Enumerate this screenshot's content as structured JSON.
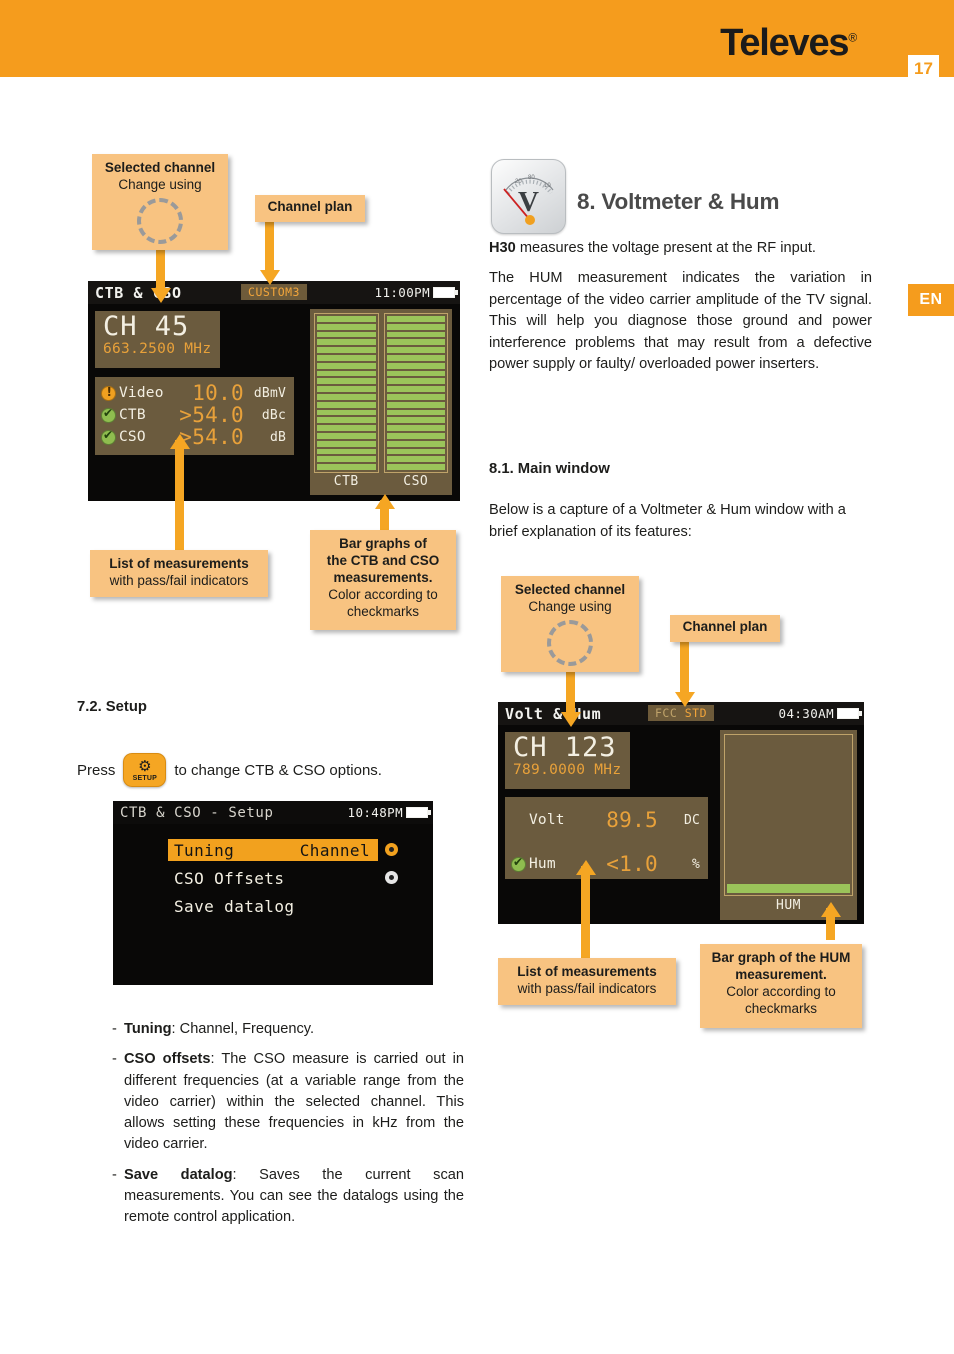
{
  "header": {
    "brand": "Televes",
    "brand_mark": "®",
    "page_number": "17",
    "accent_color": "#F59C1D"
  },
  "language_tab": {
    "label": "EN"
  },
  "left_column": {
    "screen1": {
      "title": "CTB & CSO",
      "channel_plan": "CUSTOM3",
      "time": "11:00PM",
      "channel": "CH 45",
      "frequency": "663.2500 MHz",
      "measurements": [
        {
          "icon": "warning-icon",
          "label": "Video",
          "value": "10.0",
          "unit": "dBmV"
        },
        {
          "icon": "check-icon",
          "label": "CTB",
          "value": ">54.0",
          "unit": "dBc"
        },
        {
          "icon": "check-icon",
          "label": "CSO",
          "value": ">54.0",
          "unit": "dB"
        }
      ],
      "bars": [
        {
          "label": "CTB",
          "segments": 20,
          "color": "#9BC45A"
        },
        {
          "label": "CSO",
          "segments": 20,
          "color": "#9BC45A"
        }
      ]
    },
    "callouts": {
      "selected_channel_title": "Selected channel",
      "selected_channel_sub": "Change using",
      "channel_plan": "Channel plan",
      "list_title": "List of measurements",
      "list_sub": "with pass/fail indicators",
      "bars_line1": "Bar graphs of",
      "bars_line2": "the CTB and CSO",
      "bars_line3": "measurements.",
      "bars_line4": "Color according to",
      "bars_line5": "checkmarks"
    },
    "setup_heading": "7.2. Setup",
    "setup_press_before": "Press",
    "setup_key_label": "SETUP",
    "setup_press_after": "to change CTB & CSO options.",
    "screen2": {
      "title": "CTB & CSO - Setup",
      "time": "10:48PM",
      "menu": [
        {
          "label": "Tuning",
          "value": "Channel",
          "selected": true,
          "dot": "orange"
        },
        {
          "label": "CSO Offsets",
          "value": "",
          "selected": false,
          "dot": "grey"
        },
        {
          "label": "Save datalog",
          "value": "",
          "selected": false,
          "dot": "none"
        }
      ]
    },
    "bullets": [
      {
        "term": "Tuning",
        "text": ": Channel, Frequency."
      },
      {
        "term": "CSO offsets",
        "text": ": The CSO measure is carried out in different frequencies (at a variable range from the video carrier) within the selected channel. This allows setting these frequencies in kHz from the video carrier."
      },
      {
        "term": "Save datalog",
        "text": ": Saves the current scan measurements. You can see the datalogs using the remote control application."
      }
    ]
  },
  "right_column": {
    "icon_name": "voltmeter-icon",
    "icon_glyph": "V",
    "section_title": "8. Voltmeter & Hum",
    "para1_bold": "H30",
    "para1_rest": " measures the voltage present at the RF input.",
    "para2": "The HUM measurement indicates the variation in percentage of the video carrier amplitude of the TV signal. This will help you diagnose those ground and power interference problems that may result from a defective power supply or faulty/ overloaded power inserters.",
    "sub_heading": "8.1. Main window",
    "para3": "Below is a capture of a Voltmeter & Hum window with a brief explanation of its features:",
    "callouts": {
      "selected_channel_title": "Selected channel",
      "selected_channel_sub": "Change using",
      "channel_plan": "Channel plan",
      "list_title": "List of measurements",
      "list_sub": "with pass/fail indicators",
      "bar_line1": "Bar graph of the HUM",
      "bar_line2": "measurement.",
      "bar_line3": "Color according to",
      "bar_line4": "checkmarks"
    },
    "screen": {
      "title": "Volt & Hum",
      "channel_plan_left": "FCC",
      "channel_plan_right": "STD",
      "time": "04:30AM",
      "channel": "CH 123",
      "frequency": "789.0000 MHz",
      "measurements": [
        {
          "icon": "none",
          "label": "Volt",
          "value": "89.5",
          "unit": "DC"
        },
        {
          "icon": "check-icon",
          "label": "Hum",
          "value": "<1.0",
          "unit": "%"
        }
      ],
      "bar": {
        "label": "HUM",
        "fill_percent": 6,
        "color": "#9BC45A"
      }
    }
  }
}
